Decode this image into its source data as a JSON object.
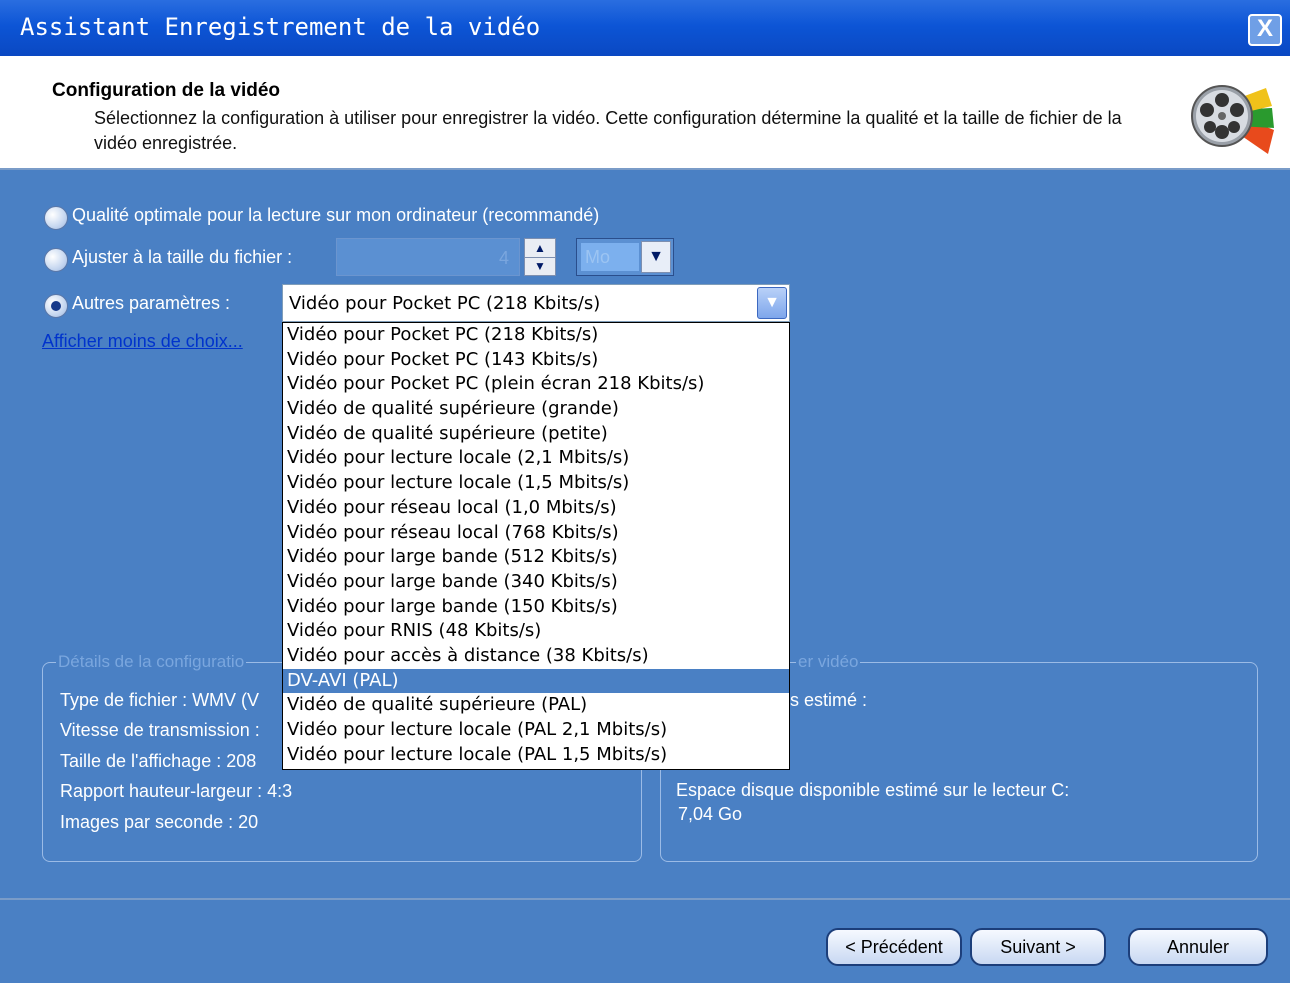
{
  "window": {
    "title": "Assistant Enregistrement de la vidéo",
    "close_glyph": "X"
  },
  "header": {
    "title": "Configuration de la vidéo",
    "description": "Sélectionnez la configuration à utiliser pour enregistrer la vidéo. Cette configuration détermine la qualité et la taille de fichier de la vidéo enregistrée.",
    "icon": "movie-film-reel-icon"
  },
  "options": {
    "optimal_label": "Qualité optimale pour la lecture sur mon ordinateur (recommandé)",
    "fit_label": "Ajuster à la taille du fichier :",
    "fit_value": "4",
    "fit_unit": "Mo",
    "other_label": "Autres paramètres :",
    "other_selected": "Vidéo pour Pocket PC (218 Kbits/s)",
    "selected_option": "other",
    "fewer_choices_link": "Afficher moins de choix..."
  },
  "dropdown": {
    "items": [
      "Vidéo pour Pocket PC (218 Kbits/s)",
      "Vidéo pour Pocket PC (143 Kbits/s)",
      "Vidéo pour Pocket PC (plein écran 218 Kbits/s)",
      "Vidéo de qualité supérieure (grande)",
      "Vidéo de qualité supérieure (petite)",
      "Vidéo pour lecture locale (2,1 Mbits/s)",
      "Vidéo pour lecture locale (1,5 Mbits/s)",
      "Vidéo pour réseau local (1,0 Mbits/s)",
      "Vidéo pour réseau local (768 Kbits/s)",
      "Vidéo pour large bande (512 Kbits/s)",
      "Vidéo pour large bande (340 Kbits/s)",
      "Vidéo pour large bande (150 Kbits/s)",
      "Vidéo pour RNIS (48 Kbits/s)",
      "Vidéo pour accès à distance (38 Kbits/s)",
      "DV-AVI (PAL)",
      "Vidéo de qualité supérieure (PAL)",
      "Vidéo pour lecture locale (PAL 2,1 Mbits/s)",
      "Vidéo pour lecture locale (PAL 1,5 Mbits/s)"
    ],
    "highlighted_index": 14
  },
  "details": {
    "title": "Détails de la configuratio",
    "file_type": "Type de fichier : WMV (V",
    "bit_rate": "Vitesse de transmission :",
    "display_size": "Taille de l'affichage : 208",
    "aspect_ratio": "Rapport hauteur-largeur : 4:3",
    "fps": "Images par seconde : 20"
  },
  "file_size": {
    "title": "er vidéo",
    "estimated_label": "s estimé :",
    "disk_space_label": "Espace disque disponible estimé sur le lecteur C:",
    "disk_space_value": "7,04 Go"
  },
  "buttons": {
    "back": "< Précédent",
    "next": "Suivant >",
    "cancel": "Annuler"
  },
  "colors": {
    "titlebar": "#0d55d6",
    "body": "#4a80c4",
    "highlight": "#4a80c4",
    "link": "#0033cc"
  }
}
